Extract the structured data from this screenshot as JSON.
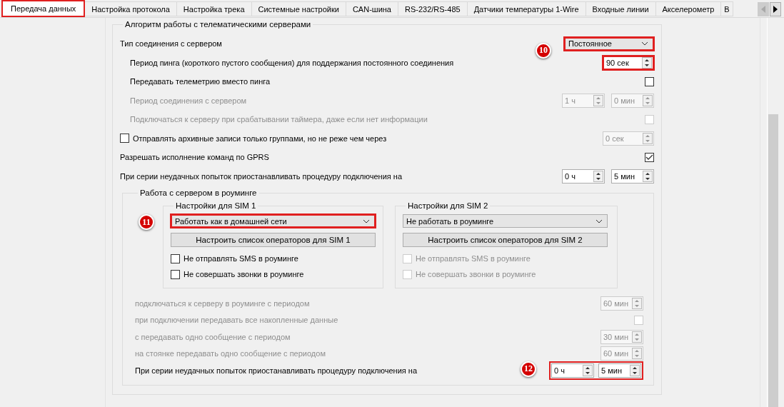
{
  "tabs": [
    {
      "label": "Передача данных",
      "selected": true,
      "highlighted": true
    },
    {
      "label": "Настройка протокола",
      "selected": false,
      "highlighted": false
    },
    {
      "label": "Настройка трека",
      "selected": false,
      "highlighted": false
    },
    {
      "label": "Системные настройки",
      "selected": false,
      "highlighted": false
    },
    {
      "label": "CAN-шина",
      "selected": false,
      "highlighted": false
    },
    {
      "label": "RS-232/RS-485",
      "selected": false,
      "highlighted": false
    },
    {
      "label": "Датчики температуры 1-Wire",
      "selected": false,
      "highlighted": false
    },
    {
      "label": "Входные линии",
      "selected": false,
      "highlighted": false
    },
    {
      "label": "Акселерометр",
      "selected": false,
      "highlighted": false
    },
    {
      "label": "В",
      "selected": false,
      "highlighted": false
    }
  ],
  "server_group": {
    "title": "Алгоритм работы с телематическими серверами",
    "rows": [
      {
        "kind": "select",
        "label": "Тип соединения с сервером",
        "disabled": false,
        "select": {
          "value": "Постоянное",
          "highlighted": true
        },
        "callout": "10",
        "children": [
          {
            "kind": "spin",
            "label": "Период пинга (короткого пустого сообщения) для поддержания постоянного соединения",
            "disabled": false,
            "spins": [
              {
                "value": "90 сек",
                "disabled": false,
                "highlighted": true
              }
            ]
          },
          {
            "kind": "check",
            "label": "Передавать телеметрию вместо пинга",
            "disabled": false,
            "checked": false
          },
          {
            "kind": "spin",
            "label": "Период соединения с сервером",
            "disabled": true,
            "spins": [
              {
                "value": "1 ч",
                "disabled": true,
                "highlighted": false
              },
              {
                "value": "0 мин",
                "disabled": true,
                "highlighted": false
              }
            ]
          },
          {
            "kind": "check",
            "label": "Подключаться к серверу при срабатывании таймера, даже если нет информации",
            "disabled": true,
            "checked": false
          }
        ]
      },
      {
        "kind": "lead-check",
        "label": "Отправлять архивные записи только группами, но не реже чем через",
        "disabled": false,
        "checked": false,
        "spins": [
          {
            "value": "0 сек",
            "disabled": true,
            "highlighted": false
          }
        ]
      },
      {
        "kind": "check",
        "label": "Разрешать исполнение команд по GPRS",
        "disabled": false,
        "checked": true
      },
      {
        "kind": "spin",
        "label": "При серии неудачных попыток приостанавливать процедуру подключения на",
        "disabled": false,
        "spins": [
          {
            "value": "0 ч",
            "disabled": false,
            "highlighted": false
          },
          {
            "value": "5 мин",
            "disabled": false,
            "highlighted": false
          }
        ]
      }
    ]
  },
  "roaming_group": {
    "title": "Работа с сервером в роуминге",
    "sims": [
      {
        "title": "Настройки для SIM 1",
        "select": {
          "value": "Работать как в домашней сети",
          "highlighted": true
        },
        "callout": "11",
        "button": "Настроить список операторов для SIM 1",
        "checks": [
          {
            "label": "Не отправлять SMS в роуминге",
            "checked": false,
            "disabled": false
          },
          {
            "label": "Не совершать звонки в роуминге",
            "checked": false,
            "disabled": false
          }
        ]
      },
      {
        "title": "Настройки для SIM 2",
        "select": {
          "value": "Не работать в роуминге",
          "highlighted": false
        },
        "button": "Настроить список операторов для SIM 2",
        "checks": [
          {
            "label": "Не отправлять SMS в роуминге",
            "checked": false,
            "disabled": true
          },
          {
            "label": "Не совершать звонки в роуминге",
            "checked": false,
            "disabled": true
          }
        ]
      }
    ],
    "rows": [
      {
        "kind": "spin",
        "label": "подключаться к серверу в роуминге с периодом",
        "disabled": true,
        "spins": [
          {
            "value": "60 мин",
            "disabled": true,
            "highlighted": false
          }
        ]
      },
      {
        "kind": "check",
        "label": "при подключении передавать все накопленные данные",
        "disabled": true,
        "checked": false
      },
      {
        "kind": "spin",
        "label": "с передавать одно сообщение с периодом",
        "disabled": true,
        "spins": [
          {
            "value": "30 мин",
            "disabled": true,
            "highlighted": false
          }
        ]
      },
      {
        "kind": "spin",
        "label": "на стоянке передавать одно сообщение с периодом",
        "disabled": true,
        "spins": [
          {
            "value": "60 мин",
            "disabled": true,
            "highlighted": false
          }
        ]
      },
      {
        "kind": "spin",
        "label": "При серии неудачных попыток приостанавливать процедуру подключения на",
        "disabled": false,
        "highlighted": true,
        "callout": "12",
        "spins": [
          {
            "value": "0 ч",
            "disabled": false,
            "highlighted": false
          },
          {
            "value": "5 мин",
            "disabled": false,
            "highlighted": false
          }
        ]
      }
    ]
  }
}
